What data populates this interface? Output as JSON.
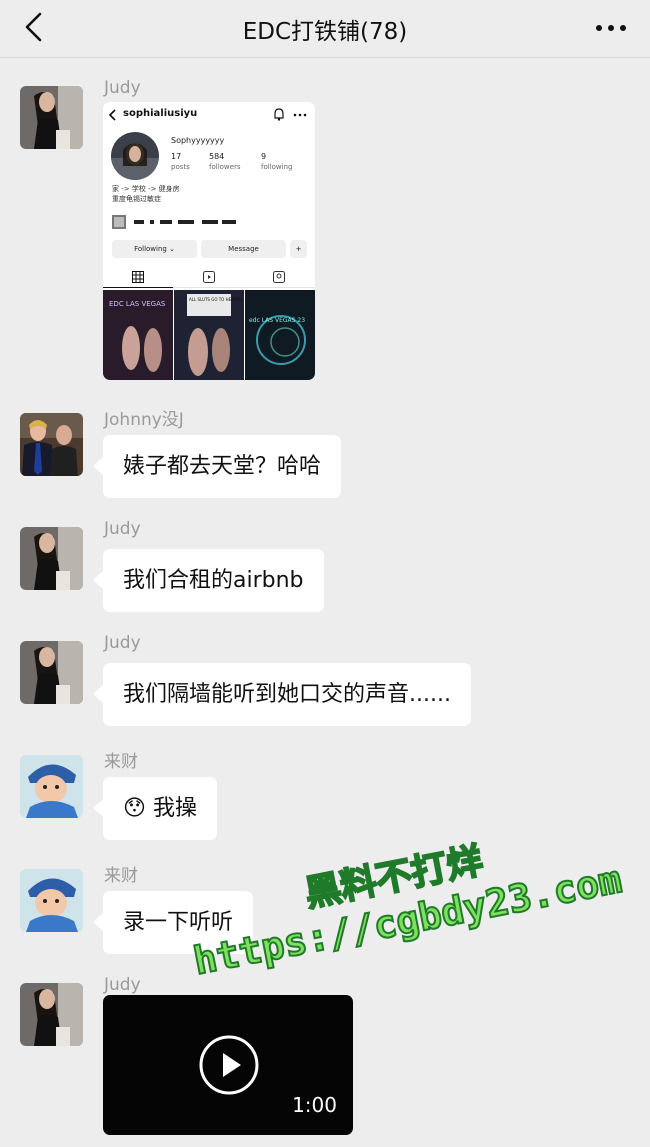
{
  "header": {
    "title": "EDC打铁铺(78)"
  },
  "messages": [
    {
      "sender": "Judy",
      "type": "image",
      "instagram": {
        "username": "sophialiusiyu",
        "display_name": "Sophyyyyyyy",
        "stats": [
          {
            "value": "17",
            "label": "posts"
          },
          {
            "value": "584",
            "label": "followers"
          },
          {
            "value": "9",
            "label": "following"
          }
        ],
        "bio_line1": "家 -> 学校 -> 健身房",
        "bio_line2": "重度龟锡过敏症",
        "buttons": {
          "following": "Following ⌄",
          "message": "Message"
        },
        "posts": [
          {
            "overlay": "EDC LAS VEGAS"
          },
          {
            "overlay": "ALL SLUTS GO TO HEAVEN"
          },
          {
            "overlay": "edc LAS VEGAS 23"
          }
        ]
      }
    },
    {
      "sender": "Johnny没J",
      "type": "text",
      "text": "婊子都去天堂？哈哈"
    },
    {
      "sender": "Judy",
      "type": "text",
      "text": "我们合租的airbnb"
    },
    {
      "sender": "Judy",
      "type": "text",
      "text": "我们隔墙能听到她口交的声音......"
    },
    {
      "sender": "来财",
      "type": "text",
      "text": "我操",
      "emoji": "😯"
    },
    {
      "sender": "来财",
      "type": "text",
      "text": "录一下听听"
    },
    {
      "sender": "Judy",
      "type": "video",
      "duration": "1:00"
    }
  ],
  "watermark": {
    "line1": "黑料不打烊",
    "line2": "https://cgbdy23.com",
    "fill_color": "#7ee05c",
    "stroke_color": "#1f7a2a"
  },
  "colors": {
    "background": "#ededed",
    "bubble": "#ffffff",
    "sender_name": "#9a9a9a"
  }
}
